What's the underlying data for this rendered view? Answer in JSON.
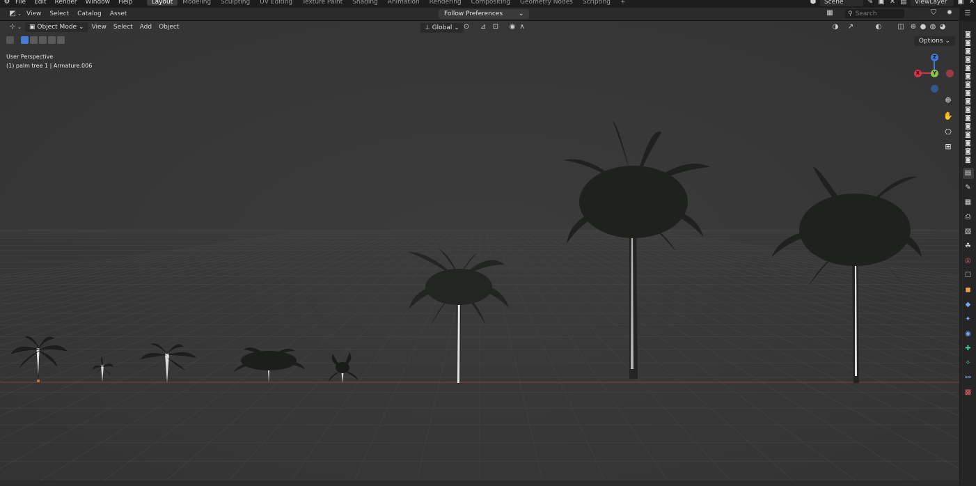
{
  "top_menu": {
    "items": [
      "File",
      "Edit",
      "Render",
      "Window",
      "Help"
    ],
    "workspaces": [
      "Layout",
      "Modeling",
      "Sculpting",
      "UV Editing",
      "Texture Paint",
      "Shading",
      "Animation",
      "Rendering",
      "Compositing",
      "Geometry Nodes",
      "Scripting",
      "+"
    ],
    "active_workspace": "Layout",
    "scene_label": "Scene",
    "view_layer_label": "ViewLayer"
  },
  "asset_header": {
    "menus": [
      "View",
      "Select",
      "Catalog",
      "Asset"
    ],
    "follow_prefs": "Follow Preferences",
    "search_placeholder": "Search"
  },
  "viewport_header": {
    "mode": "Object Mode",
    "menus": [
      "View",
      "Select",
      "Add",
      "Object"
    ],
    "transform_orientation": "Global",
    "options_label": "Options"
  },
  "viewport_overlay": {
    "line1": "User Perspective",
    "line2": "(1) palm tree 1 | Armature.006"
  },
  "gizmo": {
    "z_label": "Z",
    "y_label": "Y",
    "x_label": "X",
    "x_color": "#d8334a",
    "y_color": "#8bc34a",
    "z_color": "#3d7bd9"
  },
  "colors": {
    "viewport_bg": "#3a3a3a",
    "x_axis_line": "#9a3a46",
    "foliage": "#1f221f",
    "trunk_highlight": "#e6e6e6"
  }
}
